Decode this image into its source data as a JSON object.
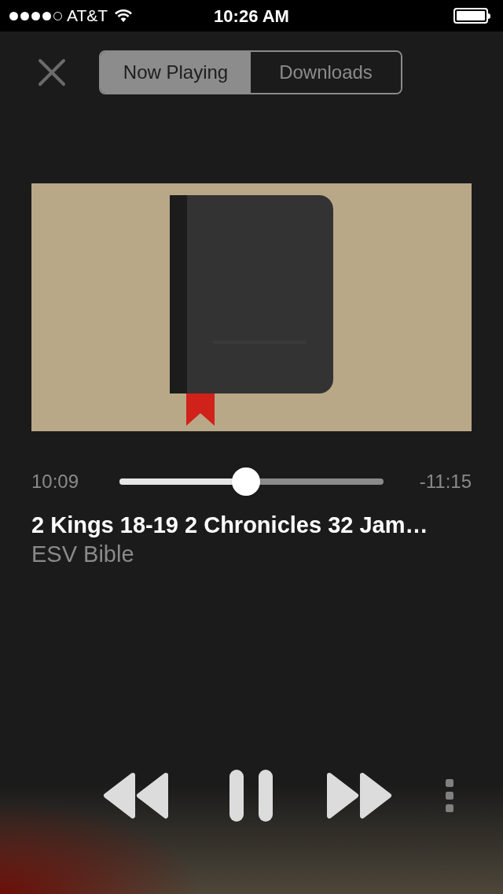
{
  "status_bar": {
    "carrier": "AT&T",
    "time": "10:26 AM"
  },
  "tabs": [
    {
      "label": "Now Playing",
      "selected": true
    },
    {
      "label": "Downloads",
      "selected": false
    }
  ],
  "progress": {
    "elapsed": "10:09",
    "remaining": "-11:15",
    "level": 0.48
  },
  "track": {
    "title": "2 Kings 18-19 2 Chronicles 32 Jam…",
    "subtitle": "ESV Bible"
  },
  "playback": {
    "playing": true
  }
}
